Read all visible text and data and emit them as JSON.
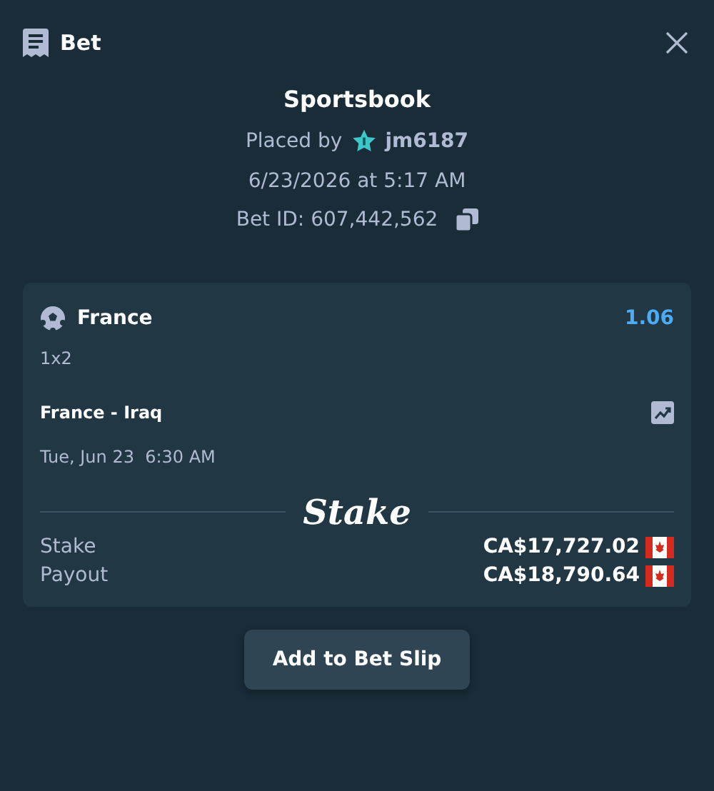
{
  "header": {
    "title": "Bet"
  },
  "summary": {
    "title": "Sportsbook",
    "placed_by_label": "Placed by",
    "username": "jm6187",
    "date": "6/23/2026 at 5:17 AM",
    "bet_id": "Bet ID: 607,442,562"
  },
  "selection": {
    "team": "France",
    "odds": "1.06",
    "market": "1x2",
    "event": "France - Iraq",
    "start": "Tue, Jun 23  6:30 AM"
  },
  "logo": "Stake",
  "amounts": [
    {
      "label": "Stake",
      "value": "CA$17,727.02"
    },
    {
      "label": "Payout",
      "value": "CA$18,790.64"
    }
  ],
  "button": "Add to Bet Slip"
}
